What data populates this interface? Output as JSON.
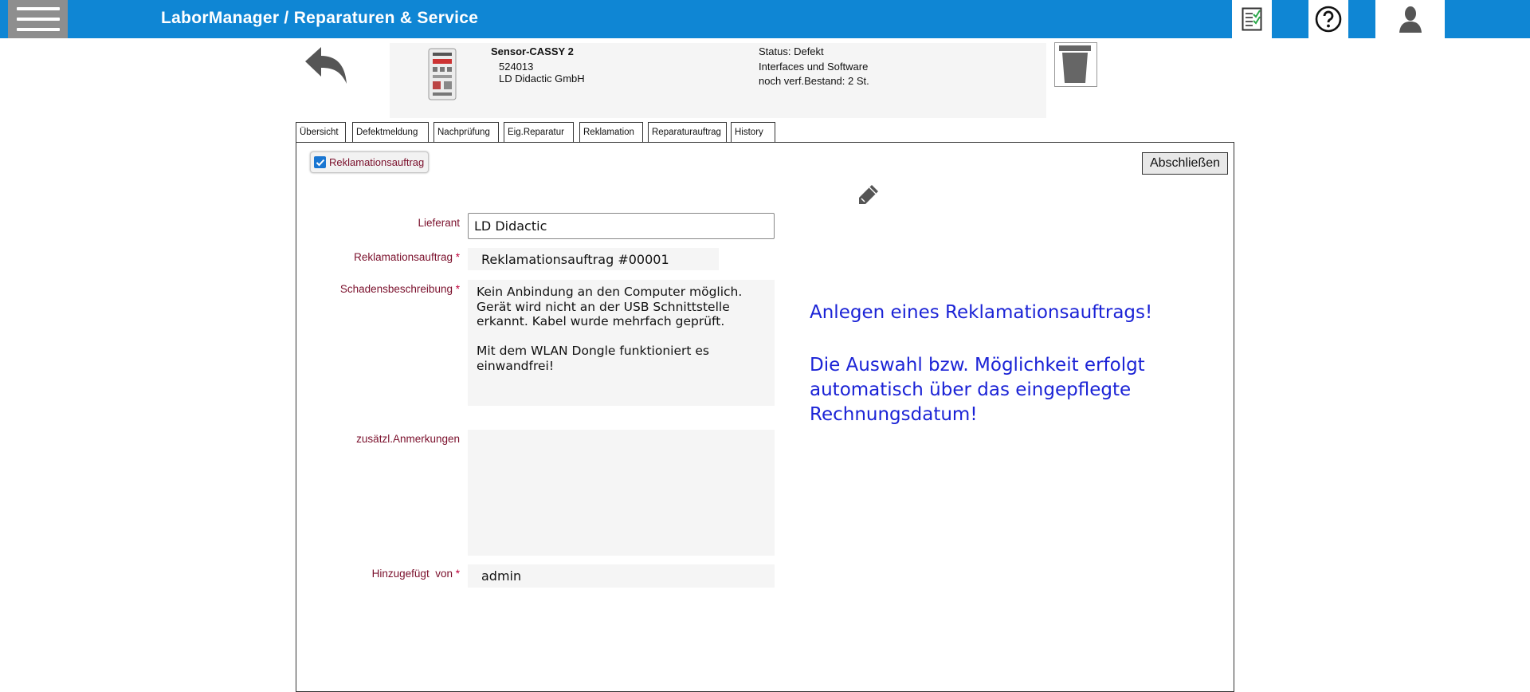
{
  "header": {
    "app_title": "LaborManager / Reparaturen & Service"
  },
  "device": {
    "name": "Sensor-CASSY 2",
    "number": "524013",
    "manufacturer": "LD Didactic GmbH",
    "status": "Status: Defekt",
    "category": "Interfaces und Software",
    "stock": "noch verf.Bestand: 2 St."
  },
  "tabs": [
    "Übersicht",
    "Defektmeldung",
    "Nachprüfung",
    "Eig.Reparatur",
    "Reklamation",
    "Reparaturauftrag",
    "History"
  ],
  "active_tab": "Reklamation",
  "form": {
    "checkbox_label": "Reklamationsauftrag",
    "checkbox_checked": true,
    "close_button": "Abschließen",
    "lieferant_label": "Lieferant",
    "lieferant_value": "LD Didactic",
    "reklamation_label": "Reklamationsauftrag",
    "reklamation_value": "Reklamationsauftrag #00001",
    "schaden_label": "Schadensbeschreibung",
    "schaden_value": "Kein Anbindung an den Computer möglich.\nGerät wird nicht an der USB Schnittstelle\nerkannt. Kabel wurde mehrfach geprüft.\n\nMit dem WLAN Dongle funktioniert es\neinwandfrei!",
    "anmerkungen_label": "zusätzl.Anmerkungen",
    "anmerkungen_value": "",
    "added_by_label": "Hinzugefügt  von",
    "added_by_value": "admin",
    "required_mark": "*"
  },
  "note": {
    "line1": "Anlegen eines Reklamationsauftrags!",
    "line2": "Die Auswahl bzw. Möglichkeit erfolgt",
    "line3": "automatisch über das eingepflegte",
    "line4": "Rechnungsdatum!"
  },
  "colors": {
    "topbar": "#0f86d4",
    "label": "#7a0f2b",
    "note": "#1b23d6"
  },
  "icons": [
    "menu-icon",
    "checklist-icon",
    "help-icon",
    "user-icon",
    "back-arrow-icon",
    "trash-icon",
    "pencil-icon"
  ]
}
